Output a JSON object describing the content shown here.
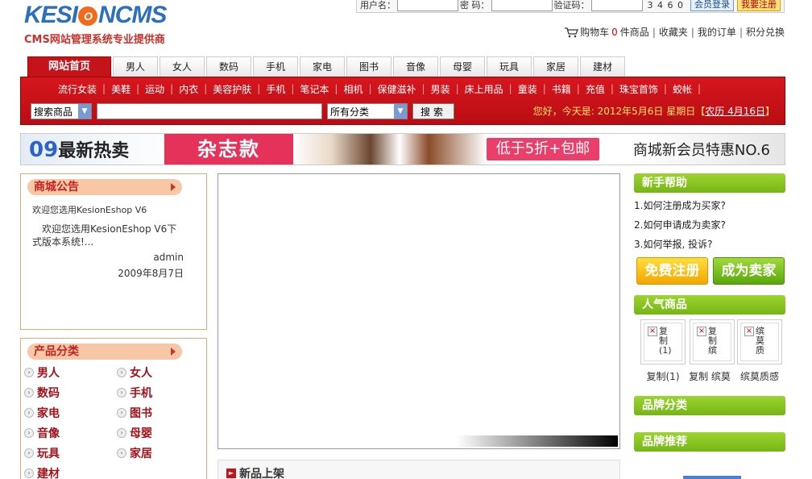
{
  "logo": {
    "main_a": "KESI",
    "main_b": "NCMS",
    "main_o": "O",
    "sub": "CMS网站管理系统专业提供商"
  },
  "login": {
    "user_label": "用户名：",
    "pwd_label": "密 码：",
    "code_label": "验证码：",
    "captcha": "3 4 6 0",
    "login_btn": "会员登录",
    "reg_btn": "我要注册"
  },
  "toplinks": {
    "cart": "购物车",
    "cart_count": "0",
    "cart_unit": "件商品",
    "favorites": "收藏夹",
    "orders": "我的订单",
    "points": "积分兑换"
  },
  "nav": {
    "tabs": [
      "网站首页",
      "男人",
      "女人",
      "数码",
      "手机",
      "家电",
      "图书",
      "音像",
      "母婴",
      "玩具",
      "家居",
      "建材"
    ]
  },
  "subnav": [
    "流行女装",
    "美鞋",
    "运动",
    "内衣",
    "美容护肤",
    "手机",
    "笔记本",
    "相机",
    "保健滋补",
    "男装",
    "床上用品",
    "童装",
    "书籍",
    "充值",
    "珠宝首饰",
    "蛟帐"
  ],
  "search": {
    "type_selected": "搜索商品",
    "cat_selected": "所有分类",
    "btn": "搜索",
    "greeting": "您好，今天是: 2012年5月6日 星期日",
    "lunar": "农历 4月16日"
  },
  "banner": {
    "num": "09",
    "hot": "最新热卖",
    "magazine": "杂志款",
    "discount": "低于5折+包邮",
    "member": "商城新会员特惠NO.6"
  },
  "notice": {
    "title": "商城公告",
    "item_title": "欢迎您选用KesionEshop V6",
    "item_body": "欢迎您选用KesionEshop V6下式版本系统!...",
    "author": "admin",
    "date": "2009年8月7日"
  },
  "categories": {
    "title": "产品分类",
    "items": [
      "男人",
      "女人",
      "数码",
      "手机",
      "家电",
      "图书",
      "音像",
      "母婴",
      "玩具",
      "家居",
      "建材"
    ]
  },
  "newprod": {
    "title": "新品上架"
  },
  "help": {
    "title": "新手帮助",
    "items": [
      "1.如何注册成为买家?",
      "2.如何申请成为卖家?",
      "3.如何举报, 投诉?"
    ],
    "free_reg": "免费注册",
    "become_seller": "成为卖家"
  },
  "hot": {
    "title": "人气商品",
    "items": [
      {
        "img_text": "复制(1)",
        "caption": "复制(1)"
      },
      {
        "img_text": "复制缤",
        "caption": "复制 缤莫"
      },
      {
        "img_text": "缤莫质",
        "caption": "缤莫质感"
      }
    ]
  },
  "brand_cat": {
    "title": "品牌分类"
  },
  "brand_rec": {
    "title": "品牌推荐"
  }
}
